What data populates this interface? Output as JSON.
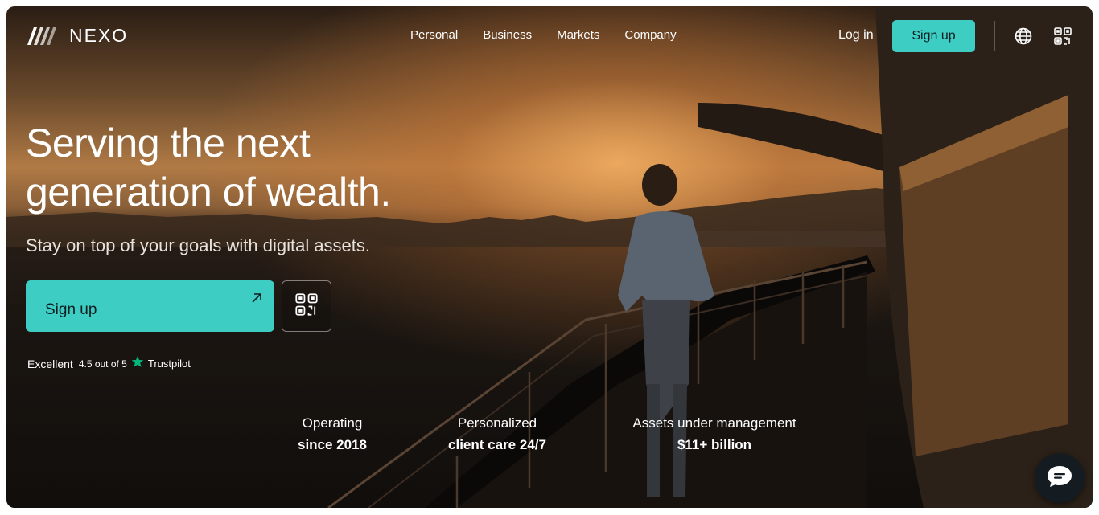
{
  "brand": {
    "name": "NEXO"
  },
  "nav": {
    "items": [
      "Personal",
      "Business",
      "Markets",
      "Company"
    ]
  },
  "header": {
    "login_label": "Log in",
    "signup_label": "Sign up",
    "globe_icon": "globe-icon",
    "qr_icon": "qr-code-icon"
  },
  "hero": {
    "title_line1": "Serving the next",
    "title_line2": "generation of wealth.",
    "subtitle": "Stay on top of your goals with digital assets.",
    "signup_label": "Sign up",
    "arrow_icon": "arrow-up-right-icon",
    "qr_icon": "qr-code-icon"
  },
  "trustpilot": {
    "rating_text": "Excellent",
    "score_text": "4.5 out of 5",
    "brand": "Trustpilot",
    "star_icon": "star-icon",
    "star_color": "#00b67a"
  },
  "stats": [
    {
      "line1": "Operating",
      "line2": "since 2018"
    },
    {
      "line1": "Personalized",
      "line2": "client care 24/7"
    },
    {
      "line1": "Assets under management",
      "line2": "$11+ billion"
    }
  ],
  "chat": {
    "icon": "chat-icon"
  },
  "colors": {
    "accent": "#3dcdc3"
  }
}
